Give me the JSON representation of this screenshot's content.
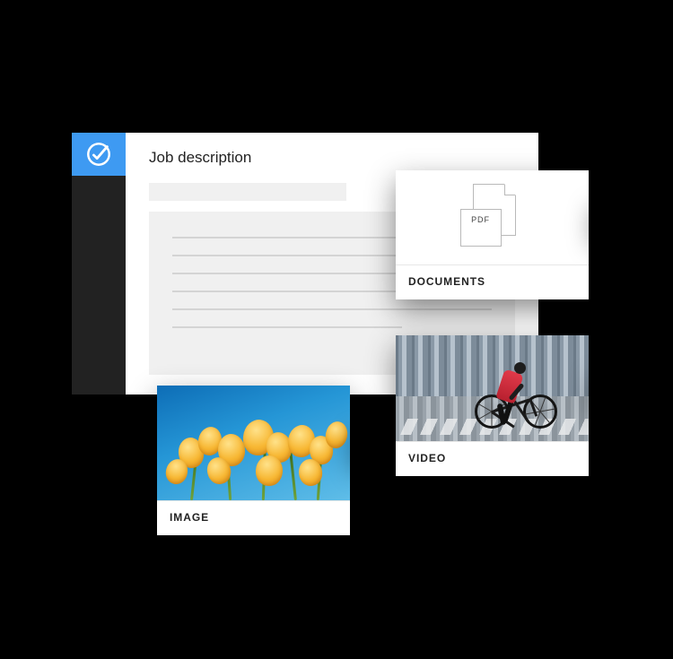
{
  "window": {
    "title": "Job description"
  },
  "cards": {
    "documents": {
      "label": "DOCUMENTS",
      "badge": "PDF"
    },
    "video": {
      "label": "VIDEO"
    },
    "image": {
      "label": "IMAGE"
    }
  },
  "colors": {
    "accent": "#3e9af2"
  }
}
